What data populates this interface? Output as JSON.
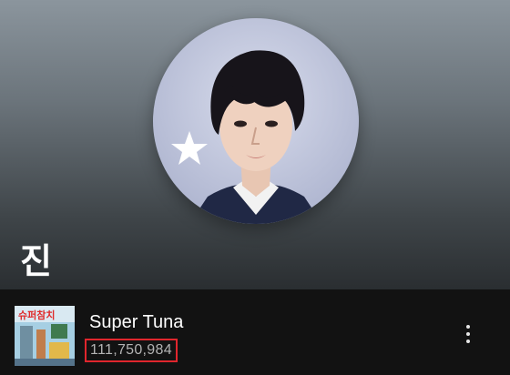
{
  "artist": {
    "name": "진"
  },
  "track": {
    "title": "Super Tuna",
    "plays": "111,750,984",
    "cover_text": "슈퍼참치"
  },
  "icons": {
    "more": "more-vertical-icon"
  },
  "colors": {
    "background": "#121212",
    "highlight_box": "#e0262d",
    "secondary_text": "#b3b3b3"
  }
}
